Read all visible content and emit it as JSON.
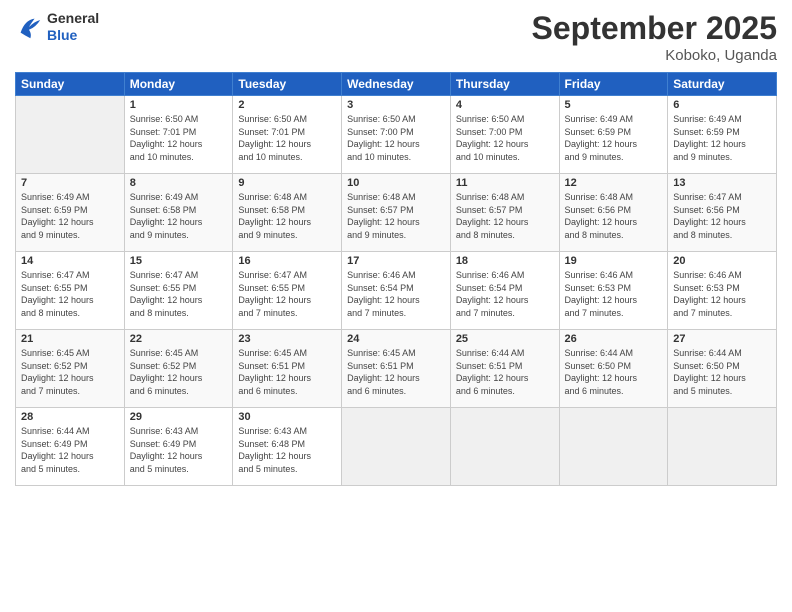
{
  "header": {
    "logo_line1": "General",
    "logo_line2": "Blue",
    "month": "September 2025",
    "location": "Koboko, Uganda"
  },
  "weekdays": [
    "Sunday",
    "Monday",
    "Tuesday",
    "Wednesday",
    "Thursday",
    "Friday",
    "Saturday"
  ],
  "weeks": [
    [
      {
        "day": "",
        "info": ""
      },
      {
        "day": "1",
        "info": "Sunrise: 6:50 AM\nSunset: 7:01 PM\nDaylight: 12 hours\nand 10 minutes."
      },
      {
        "day": "2",
        "info": "Sunrise: 6:50 AM\nSunset: 7:01 PM\nDaylight: 12 hours\nand 10 minutes."
      },
      {
        "day": "3",
        "info": "Sunrise: 6:50 AM\nSunset: 7:00 PM\nDaylight: 12 hours\nand 10 minutes."
      },
      {
        "day": "4",
        "info": "Sunrise: 6:50 AM\nSunset: 7:00 PM\nDaylight: 12 hours\nand 10 minutes."
      },
      {
        "day": "5",
        "info": "Sunrise: 6:49 AM\nSunset: 6:59 PM\nDaylight: 12 hours\nand 9 minutes."
      },
      {
        "day": "6",
        "info": "Sunrise: 6:49 AM\nSunset: 6:59 PM\nDaylight: 12 hours\nand 9 minutes."
      }
    ],
    [
      {
        "day": "7",
        "info": "Sunrise: 6:49 AM\nSunset: 6:59 PM\nDaylight: 12 hours\nand 9 minutes."
      },
      {
        "day": "8",
        "info": "Sunrise: 6:49 AM\nSunset: 6:58 PM\nDaylight: 12 hours\nand 9 minutes."
      },
      {
        "day": "9",
        "info": "Sunrise: 6:48 AM\nSunset: 6:58 PM\nDaylight: 12 hours\nand 9 minutes."
      },
      {
        "day": "10",
        "info": "Sunrise: 6:48 AM\nSunset: 6:57 PM\nDaylight: 12 hours\nand 9 minutes."
      },
      {
        "day": "11",
        "info": "Sunrise: 6:48 AM\nSunset: 6:57 PM\nDaylight: 12 hours\nand 8 minutes."
      },
      {
        "day": "12",
        "info": "Sunrise: 6:48 AM\nSunset: 6:56 PM\nDaylight: 12 hours\nand 8 minutes."
      },
      {
        "day": "13",
        "info": "Sunrise: 6:47 AM\nSunset: 6:56 PM\nDaylight: 12 hours\nand 8 minutes."
      }
    ],
    [
      {
        "day": "14",
        "info": "Sunrise: 6:47 AM\nSunset: 6:55 PM\nDaylight: 12 hours\nand 8 minutes."
      },
      {
        "day": "15",
        "info": "Sunrise: 6:47 AM\nSunset: 6:55 PM\nDaylight: 12 hours\nand 8 minutes."
      },
      {
        "day": "16",
        "info": "Sunrise: 6:47 AM\nSunset: 6:55 PM\nDaylight: 12 hours\nand 7 minutes."
      },
      {
        "day": "17",
        "info": "Sunrise: 6:46 AM\nSunset: 6:54 PM\nDaylight: 12 hours\nand 7 minutes."
      },
      {
        "day": "18",
        "info": "Sunrise: 6:46 AM\nSunset: 6:54 PM\nDaylight: 12 hours\nand 7 minutes."
      },
      {
        "day": "19",
        "info": "Sunrise: 6:46 AM\nSunset: 6:53 PM\nDaylight: 12 hours\nand 7 minutes."
      },
      {
        "day": "20",
        "info": "Sunrise: 6:46 AM\nSunset: 6:53 PM\nDaylight: 12 hours\nand 7 minutes."
      }
    ],
    [
      {
        "day": "21",
        "info": "Sunrise: 6:45 AM\nSunset: 6:52 PM\nDaylight: 12 hours\nand 7 minutes."
      },
      {
        "day": "22",
        "info": "Sunrise: 6:45 AM\nSunset: 6:52 PM\nDaylight: 12 hours\nand 6 minutes."
      },
      {
        "day": "23",
        "info": "Sunrise: 6:45 AM\nSunset: 6:51 PM\nDaylight: 12 hours\nand 6 minutes."
      },
      {
        "day": "24",
        "info": "Sunrise: 6:45 AM\nSunset: 6:51 PM\nDaylight: 12 hours\nand 6 minutes."
      },
      {
        "day": "25",
        "info": "Sunrise: 6:44 AM\nSunset: 6:51 PM\nDaylight: 12 hours\nand 6 minutes."
      },
      {
        "day": "26",
        "info": "Sunrise: 6:44 AM\nSunset: 6:50 PM\nDaylight: 12 hours\nand 6 minutes."
      },
      {
        "day": "27",
        "info": "Sunrise: 6:44 AM\nSunset: 6:50 PM\nDaylight: 12 hours\nand 5 minutes."
      }
    ],
    [
      {
        "day": "28",
        "info": "Sunrise: 6:44 AM\nSunset: 6:49 PM\nDaylight: 12 hours\nand 5 minutes."
      },
      {
        "day": "29",
        "info": "Sunrise: 6:43 AM\nSunset: 6:49 PM\nDaylight: 12 hours\nand 5 minutes."
      },
      {
        "day": "30",
        "info": "Sunrise: 6:43 AM\nSunset: 6:48 PM\nDaylight: 12 hours\nand 5 minutes."
      },
      {
        "day": "",
        "info": ""
      },
      {
        "day": "",
        "info": ""
      },
      {
        "day": "",
        "info": ""
      },
      {
        "day": "",
        "info": ""
      }
    ]
  ]
}
